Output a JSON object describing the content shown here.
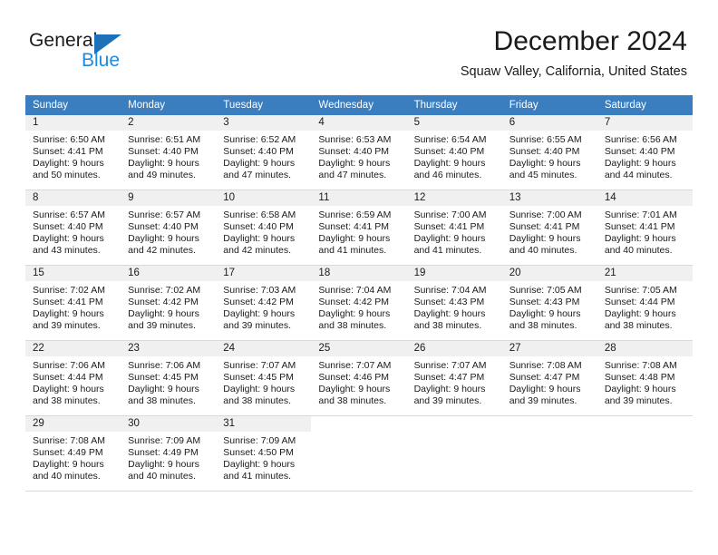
{
  "brand": {
    "name_part1": "General",
    "name_part2": "Blue",
    "triangle_icon": "triangle-icon",
    "accent_color": "#1c8ade",
    "triangle_color": "#1c71b9"
  },
  "header": {
    "month_title": "December 2024",
    "location": "Squaw Valley, California, United States"
  },
  "calendar": {
    "header_bg": "#3a7ebf",
    "weekday_headers": [
      "Sunday",
      "Monday",
      "Tuesday",
      "Wednesday",
      "Thursday",
      "Friday",
      "Saturday"
    ],
    "weeks": [
      [
        {
          "day": "1",
          "sunrise": "Sunrise: 6:50 AM",
          "sunset": "Sunset: 4:41 PM",
          "daylight_line1": "Daylight: 9 hours",
          "daylight_line2": "and 50 minutes."
        },
        {
          "day": "2",
          "sunrise": "Sunrise: 6:51 AM",
          "sunset": "Sunset: 4:40 PM",
          "daylight_line1": "Daylight: 9 hours",
          "daylight_line2": "and 49 minutes."
        },
        {
          "day": "3",
          "sunrise": "Sunrise: 6:52 AM",
          "sunset": "Sunset: 4:40 PM",
          "daylight_line1": "Daylight: 9 hours",
          "daylight_line2": "and 47 minutes."
        },
        {
          "day": "4",
          "sunrise": "Sunrise: 6:53 AM",
          "sunset": "Sunset: 4:40 PM",
          "daylight_line1": "Daylight: 9 hours",
          "daylight_line2": "and 47 minutes."
        },
        {
          "day": "5",
          "sunrise": "Sunrise: 6:54 AM",
          "sunset": "Sunset: 4:40 PM",
          "daylight_line1": "Daylight: 9 hours",
          "daylight_line2": "and 46 minutes."
        },
        {
          "day": "6",
          "sunrise": "Sunrise: 6:55 AM",
          "sunset": "Sunset: 4:40 PM",
          "daylight_line1": "Daylight: 9 hours",
          "daylight_line2": "and 45 minutes."
        },
        {
          "day": "7",
          "sunrise": "Sunrise: 6:56 AM",
          "sunset": "Sunset: 4:40 PM",
          "daylight_line1": "Daylight: 9 hours",
          "daylight_line2": "and 44 minutes."
        }
      ],
      [
        {
          "day": "8",
          "sunrise": "Sunrise: 6:57 AM",
          "sunset": "Sunset: 4:40 PM",
          "daylight_line1": "Daylight: 9 hours",
          "daylight_line2": "and 43 minutes."
        },
        {
          "day": "9",
          "sunrise": "Sunrise: 6:57 AM",
          "sunset": "Sunset: 4:40 PM",
          "daylight_line1": "Daylight: 9 hours",
          "daylight_line2": "and 42 minutes."
        },
        {
          "day": "10",
          "sunrise": "Sunrise: 6:58 AM",
          "sunset": "Sunset: 4:40 PM",
          "daylight_line1": "Daylight: 9 hours",
          "daylight_line2": "and 42 minutes."
        },
        {
          "day": "11",
          "sunrise": "Sunrise: 6:59 AM",
          "sunset": "Sunset: 4:41 PM",
          "daylight_line1": "Daylight: 9 hours",
          "daylight_line2": "and 41 minutes."
        },
        {
          "day": "12",
          "sunrise": "Sunrise: 7:00 AM",
          "sunset": "Sunset: 4:41 PM",
          "daylight_line1": "Daylight: 9 hours",
          "daylight_line2": "and 41 minutes."
        },
        {
          "day": "13",
          "sunrise": "Sunrise: 7:00 AM",
          "sunset": "Sunset: 4:41 PM",
          "daylight_line1": "Daylight: 9 hours",
          "daylight_line2": "and 40 minutes."
        },
        {
          "day": "14",
          "sunrise": "Sunrise: 7:01 AM",
          "sunset": "Sunset: 4:41 PM",
          "daylight_line1": "Daylight: 9 hours",
          "daylight_line2": "and 40 minutes."
        }
      ],
      [
        {
          "day": "15",
          "sunrise": "Sunrise: 7:02 AM",
          "sunset": "Sunset: 4:41 PM",
          "daylight_line1": "Daylight: 9 hours",
          "daylight_line2": "and 39 minutes."
        },
        {
          "day": "16",
          "sunrise": "Sunrise: 7:02 AM",
          "sunset": "Sunset: 4:42 PM",
          "daylight_line1": "Daylight: 9 hours",
          "daylight_line2": "and 39 minutes."
        },
        {
          "day": "17",
          "sunrise": "Sunrise: 7:03 AM",
          "sunset": "Sunset: 4:42 PM",
          "daylight_line1": "Daylight: 9 hours",
          "daylight_line2": "and 39 minutes."
        },
        {
          "day": "18",
          "sunrise": "Sunrise: 7:04 AM",
          "sunset": "Sunset: 4:42 PM",
          "daylight_line1": "Daylight: 9 hours",
          "daylight_line2": "and 38 minutes."
        },
        {
          "day": "19",
          "sunrise": "Sunrise: 7:04 AM",
          "sunset": "Sunset: 4:43 PM",
          "daylight_line1": "Daylight: 9 hours",
          "daylight_line2": "and 38 minutes."
        },
        {
          "day": "20",
          "sunrise": "Sunrise: 7:05 AM",
          "sunset": "Sunset: 4:43 PM",
          "daylight_line1": "Daylight: 9 hours",
          "daylight_line2": "and 38 minutes."
        },
        {
          "day": "21",
          "sunrise": "Sunrise: 7:05 AM",
          "sunset": "Sunset: 4:44 PM",
          "daylight_line1": "Daylight: 9 hours",
          "daylight_line2": "and 38 minutes."
        }
      ],
      [
        {
          "day": "22",
          "sunrise": "Sunrise: 7:06 AM",
          "sunset": "Sunset: 4:44 PM",
          "daylight_line1": "Daylight: 9 hours",
          "daylight_line2": "and 38 minutes."
        },
        {
          "day": "23",
          "sunrise": "Sunrise: 7:06 AM",
          "sunset": "Sunset: 4:45 PM",
          "daylight_line1": "Daylight: 9 hours",
          "daylight_line2": "and 38 minutes."
        },
        {
          "day": "24",
          "sunrise": "Sunrise: 7:07 AM",
          "sunset": "Sunset: 4:45 PM",
          "daylight_line1": "Daylight: 9 hours",
          "daylight_line2": "and 38 minutes."
        },
        {
          "day": "25",
          "sunrise": "Sunrise: 7:07 AM",
          "sunset": "Sunset: 4:46 PM",
          "daylight_line1": "Daylight: 9 hours",
          "daylight_line2": "and 38 minutes."
        },
        {
          "day": "26",
          "sunrise": "Sunrise: 7:07 AM",
          "sunset": "Sunset: 4:47 PM",
          "daylight_line1": "Daylight: 9 hours",
          "daylight_line2": "and 39 minutes."
        },
        {
          "day": "27",
          "sunrise": "Sunrise: 7:08 AM",
          "sunset": "Sunset: 4:47 PM",
          "daylight_line1": "Daylight: 9 hours",
          "daylight_line2": "and 39 minutes."
        },
        {
          "day": "28",
          "sunrise": "Sunrise: 7:08 AM",
          "sunset": "Sunset: 4:48 PM",
          "daylight_line1": "Daylight: 9 hours",
          "daylight_line2": "and 39 minutes."
        }
      ],
      [
        {
          "day": "29",
          "sunrise": "Sunrise: 7:08 AM",
          "sunset": "Sunset: 4:49 PM",
          "daylight_line1": "Daylight: 9 hours",
          "daylight_line2": "and 40 minutes."
        },
        {
          "day": "30",
          "sunrise": "Sunrise: 7:09 AM",
          "sunset": "Sunset: 4:49 PM",
          "daylight_line1": "Daylight: 9 hours",
          "daylight_line2": "and 40 minutes."
        },
        {
          "day": "31",
          "sunrise": "Sunrise: 7:09 AM",
          "sunset": "Sunset: 4:50 PM",
          "daylight_line1": "Daylight: 9 hours",
          "daylight_line2": "and 41 minutes."
        },
        null,
        null,
        null,
        null
      ]
    ]
  }
}
